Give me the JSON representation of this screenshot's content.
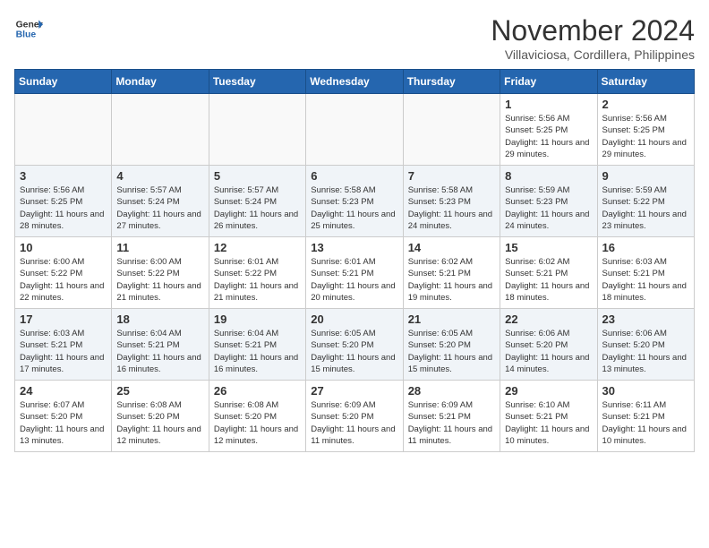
{
  "header": {
    "logo_line1": "General",
    "logo_line2": "Blue",
    "month": "November 2024",
    "location": "Villaviciosa, Cordillera, Philippines"
  },
  "days_of_week": [
    "Sunday",
    "Monday",
    "Tuesday",
    "Wednesday",
    "Thursday",
    "Friday",
    "Saturday"
  ],
  "weeks": [
    [
      {
        "day": "",
        "info": ""
      },
      {
        "day": "",
        "info": ""
      },
      {
        "day": "",
        "info": ""
      },
      {
        "day": "",
        "info": ""
      },
      {
        "day": "",
        "info": ""
      },
      {
        "day": "1",
        "info": "Sunrise: 5:56 AM\nSunset: 5:25 PM\nDaylight: 11 hours and 29 minutes."
      },
      {
        "day": "2",
        "info": "Sunrise: 5:56 AM\nSunset: 5:25 PM\nDaylight: 11 hours and 29 minutes."
      }
    ],
    [
      {
        "day": "3",
        "info": "Sunrise: 5:56 AM\nSunset: 5:25 PM\nDaylight: 11 hours and 28 minutes."
      },
      {
        "day": "4",
        "info": "Sunrise: 5:57 AM\nSunset: 5:24 PM\nDaylight: 11 hours and 27 minutes."
      },
      {
        "day": "5",
        "info": "Sunrise: 5:57 AM\nSunset: 5:24 PM\nDaylight: 11 hours and 26 minutes."
      },
      {
        "day": "6",
        "info": "Sunrise: 5:58 AM\nSunset: 5:23 PM\nDaylight: 11 hours and 25 minutes."
      },
      {
        "day": "7",
        "info": "Sunrise: 5:58 AM\nSunset: 5:23 PM\nDaylight: 11 hours and 24 minutes."
      },
      {
        "day": "8",
        "info": "Sunrise: 5:59 AM\nSunset: 5:23 PM\nDaylight: 11 hours and 24 minutes."
      },
      {
        "day": "9",
        "info": "Sunrise: 5:59 AM\nSunset: 5:22 PM\nDaylight: 11 hours and 23 minutes."
      }
    ],
    [
      {
        "day": "10",
        "info": "Sunrise: 6:00 AM\nSunset: 5:22 PM\nDaylight: 11 hours and 22 minutes."
      },
      {
        "day": "11",
        "info": "Sunrise: 6:00 AM\nSunset: 5:22 PM\nDaylight: 11 hours and 21 minutes."
      },
      {
        "day": "12",
        "info": "Sunrise: 6:01 AM\nSunset: 5:22 PM\nDaylight: 11 hours and 21 minutes."
      },
      {
        "day": "13",
        "info": "Sunrise: 6:01 AM\nSunset: 5:21 PM\nDaylight: 11 hours and 20 minutes."
      },
      {
        "day": "14",
        "info": "Sunrise: 6:02 AM\nSunset: 5:21 PM\nDaylight: 11 hours and 19 minutes."
      },
      {
        "day": "15",
        "info": "Sunrise: 6:02 AM\nSunset: 5:21 PM\nDaylight: 11 hours and 18 minutes."
      },
      {
        "day": "16",
        "info": "Sunrise: 6:03 AM\nSunset: 5:21 PM\nDaylight: 11 hours and 18 minutes."
      }
    ],
    [
      {
        "day": "17",
        "info": "Sunrise: 6:03 AM\nSunset: 5:21 PM\nDaylight: 11 hours and 17 minutes."
      },
      {
        "day": "18",
        "info": "Sunrise: 6:04 AM\nSunset: 5:21 PM\nDaylight: 11 hours and 16 minutes."
      },
      {
        "day": "19",
        "info": "Sunrise: 6:04 AM\nSunset: 5:21 PM\nDaylight: 11 hours and 16 minutes."
      },
      {
        "day": "20",
        "info": "Sunrise: 6:05 AM\nSunset: 5:20 PM\nDaylight: 11 hours and 15 minutes."
      },
      {
        "day": "21",
        "info": "Sunrise: 6:05 AM\nSunset: 5:20 PM\nDaylight: 11 hours and 15 minutes."
      },
      {
        "day": "22",
        "info": "Sunrise: 6:06 AM\nSunset: 5:20 PM\nDaylight: 11 hours and 14 minutes."
      },
      {
        "day": "23",
        "info": "Sunrise: 6:06 AM\nSunset: 5:20 PM\nDaylight: 11 hours and 13 minutes."
      }
    ],
    [
      {
        "day": "24",
        "info": "Sunrise: 6:07 AM\nSunset: 5:20 PM\nDaylight: 11 hours and 13 minutes."
      },
      {
        "day": "25",
        "info": "Sunrise: 6:08 AM\nSunset: 5:20 PM\nDaylight: 11 hours and 12 minutes."
      },
      {
        "day": "26",
        "info": "Sunrise: 6:08 AM\nSunset: 5:20 PM\nDaylight: 11 hours and 12 minutes."
      },
      {
        "day": "27",
        "info": "Sunrise: 6:09 AM\nSunset: 5:20 PM\nDaylight: 11 hours and 11 minutes."
      },
      {
        "day": "28",
        "info": "Sunrise: 6:09 AM\nSunset: 5:21 PM\nDaylight: 11 hours and 11 minutes."
      },
      {
        "day": "29",
        "info": "Sunrise: 6:10 AM\nSunset: 5:21 PM\nDaylight: 11 hours and 10 minutes."
      },
      {
        "day": "30",
        "info": "Sunrise: 6:11 AM\nSunset: 5:21 PM\nDaylight: 11 hours and 10 minutes."
      }
    ]
  ]
}
